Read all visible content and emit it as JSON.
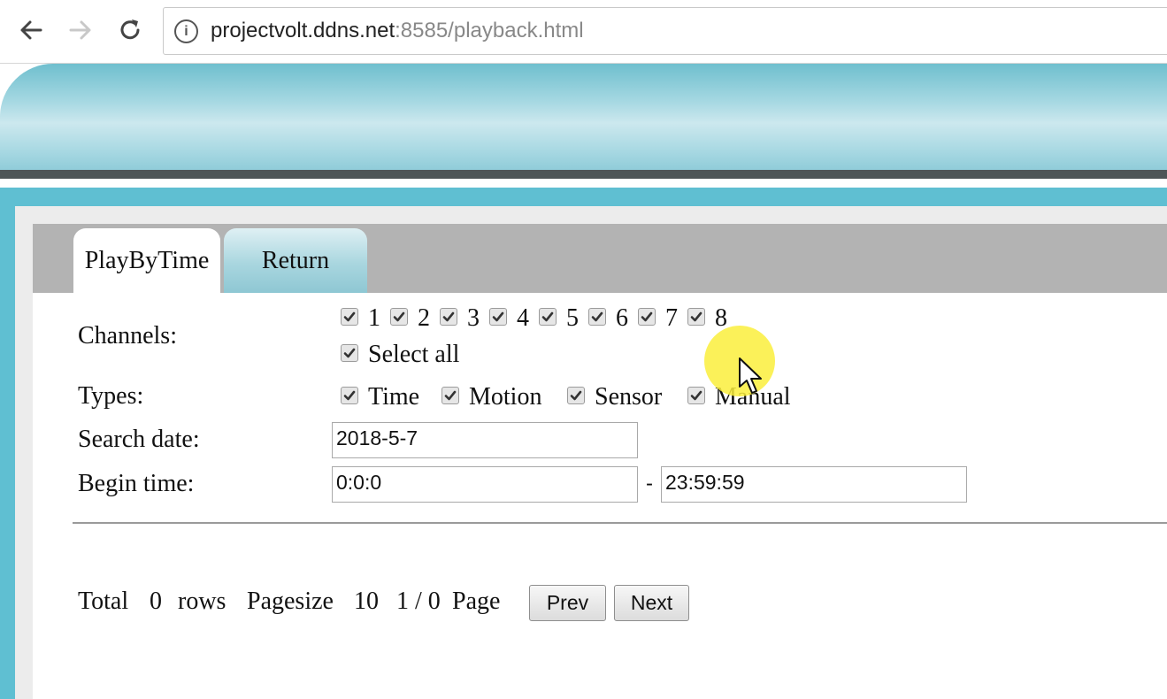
{
  "browser": {
    "url_host": "projectvolt.ddns.net",
    "url_rest": ":8585/playback.html"
  },
  "tabs": [
    {
      "label": "PlayByTime",
      "active": true
    },
    {
      "label": "Return",
      "active": false
    }
  ],
  "form": {
    "channels_label": "Channels:",
    "channels": [
      {
        "label": "1",
        "checked": true
      },
      {
        "label": "2",
        "checked": true
      },
      {
        "label": "3",
        "checked": true
      },
      {
        "label": "4",
        "checked": true
      },
      {
        "label": "5",
        "checked": true
      },
      {
        "label": "6",
        "checked": true
      },
      {
        "label": "7",
        "checked": true
      },
      {
        "label": "8",
        "checked": true
      }
    ],
    "select_all_label": "Select all",
    "types_label": "Types:",
    "types": [
      {
        "label": "Time",
        "checked": true
      },
      {
        "label": "Motion",
        "checked": true
      },
      {
        "label": "Sensor",
        "checked": true
      },
      {
        "label": "Manual",
        "checked": true
      }
    ],
    "search_date_label": "Search date:",
    "search_date_value": "2018-5-7",
    "begin_time_label": "Begin time:",
    "begin_time_value": "0:0:0",
    "time_separator": "-",
    "end_time_value": "23:59:59"
  },
  "pager": {
    "total_label": "Total",
    "total_rows": "0",
    "rows_label": "rows",
    "pagesize_label": "Pagesize",
    "pagesize": "10",
    "page_info": "1 / 0",
    "page_label": "Page",
    "prev_label": "Prev",
    "next_label": "Next"
  },
  "colors": {
    "frame_accent": "#5fbfd2",
    "cursor_highlight": "#faee3c"
  }
}
